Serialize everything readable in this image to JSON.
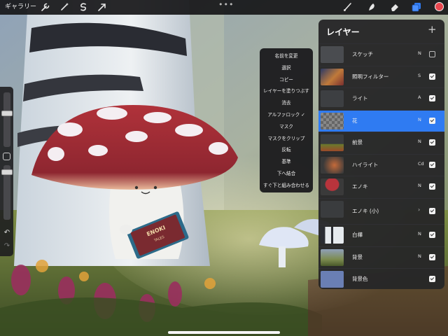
{
  "topbar": {
    "gallery_label": "ギャラリー",
    "left_tools": [
      "wrench-icon",
      "magic-wand-icon",
      "selection-icon",
      "transform-icon"
    ],
    "right_tools": [
      "brush-icon",
      "smudge-icon",
      "eraser-icon",
      "layers-icon"
    ],
    "more_label": "•••",
    "current_color": "#e8474f",
    "accent": "#2f7bf2"
  },
  "layer_menu": {
    "items": [
      {
        "label": "名前を変更"
      },
      {
        "label": "選択"
      },
      {
        "label": "コピー"
      },
      {
        "label": "レイヤーを塗りつぶす"
      },
      {
        "label": "消去"
      },
      {
        "label": "アルファロック",
        "checked": "✓"
      },
      {
        "label": "マスク"
      },
      {
        "label": "マスクをクリップ"
      },
      {
        "label": "反転"
      },
      {
        "label": "基準"
      },
      {
        "label": "下へ結合"
      },
      {
        "label": "すぐ下と組み合わせる"
      }
    ]
  },
  "layers_panel": {
    "title": "レイヤー",
    "add_label": "+",
    "layers": [
      {
        "name": "スケッチ",
        "mode": "N",
        "visible": false,
        "selected": false
      },
      {
        "name": "照明フィルター",
        "mode": "S",
        "visible": true,
        "selected": false
      },
      {
        "name": "ライト",
        "mode": "A",
        "visible": true,
        "selected": false
      },
      {
        "name": "花",
        "mode": "N",
        "visible": true,
        "selected": true
      },
      {
        "name": "前景",
        "mode": "N",
        "visible": true,
        "selected": false
      },
      {
        "name": "ハイライト",
        "mode": "Cd",
        "visible": true,
        "selected": false
      },
      {
        "name": "エノキ",
        "mode": "N",
        "visible": true,
        "selected": false
      },
      {
        "name": "エノキ (小)",
        "mode": "",
        "visible": true,
        "selected": false,
        "group": true
      },
      {
        "name": "白樺",
        "mode": "N",
        "visible": true,
        "selected": false
      },
      {
        "name": "背景",
        "mode": "N",
        "visible": true,
        "selected": false
      },
      {
        "name": "背景色",
        "mode": "",
        "visible": true,
        "selected": false
      }
    ]
  },
  "illustration": {
    "book_title": "ENOKI",
    "book_subtitle": "TALES"
  }
}
